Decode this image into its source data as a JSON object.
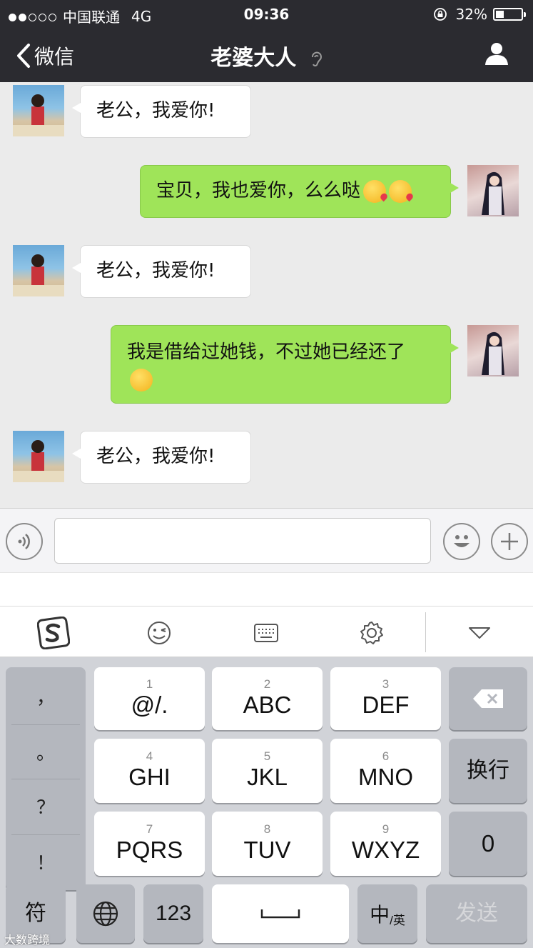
{
  "status_bar": {
    "carrier": "中国联通",
    "network": "4G",
    "time": "09:36",
    "battery_text": "32%",
    "battery_level": 0.32,
    "signal_bars_filled": 2,
    "signal_bars_total": 5
  },
  "nav": {
    "back_label": "微信",
    "title": "老婆大人"
  },
  "messages": [
    {
      "side": "in",
      "text": "老公，我爱你!"
    },
    {
      "side": "out",
      "text": "宝贝，我也爱你，么么哒",
      "emojis": [
        "kissing-heart-emoji",
        "kissing-heart-emoji"
      ]
    },
    {
      "side": "in",
      "text": "老公，我爱你!"
    },
    {
      "side": "out",
      "text": "我是借给过她钱，不过她已经还了",
      "emojis": [
        "pleading-face-emoji"
      ]
    },
    {
      "side": "in",
      "text": "老公，我爱你!"
    }
  ],
  "keyboard": {
    "punctuation": [
      "，",
      "。",
      "？",
      "！"
    ],
    "keys": [
      {
        "num": "1",
        "label": "@/."
      },
      {
        "num": "2",
        "label": "ABC"
      },
      {
        "num": "3",
        "label": "DEF"
      },
      {
        "num": "4",
        "label": "GHI"
      },
      {
        "num": "5",
        "label": "JKL"
      },
      {
        "num": "6",
        "label": "MNO"
      },
      {
        "num": "7",
        "label": "PQRS"
      },
      {
        "num": "8",
        "label": "TUV"
      },
      {
        "num": "9",
        "label": "WXYZ"
      }
    ],
    "newline_label": "换行",
    "zero_label": "0",
    "symbol_label": "符",
    "num123_label": "123",
    "lang_main": "中",
    "lang_sub": "/英",
    "space_label": "␣",
    "send_label": "发送"
  },
  "watermark": "大数跨境",
  "colors": {
    "nav_bg": "#2b2b30",
    "outgoing_bubble": "#9fe459",
    "incoming_bubble": "#ffffff",
    "chat_bg": "#ebebeb"
  }
}
